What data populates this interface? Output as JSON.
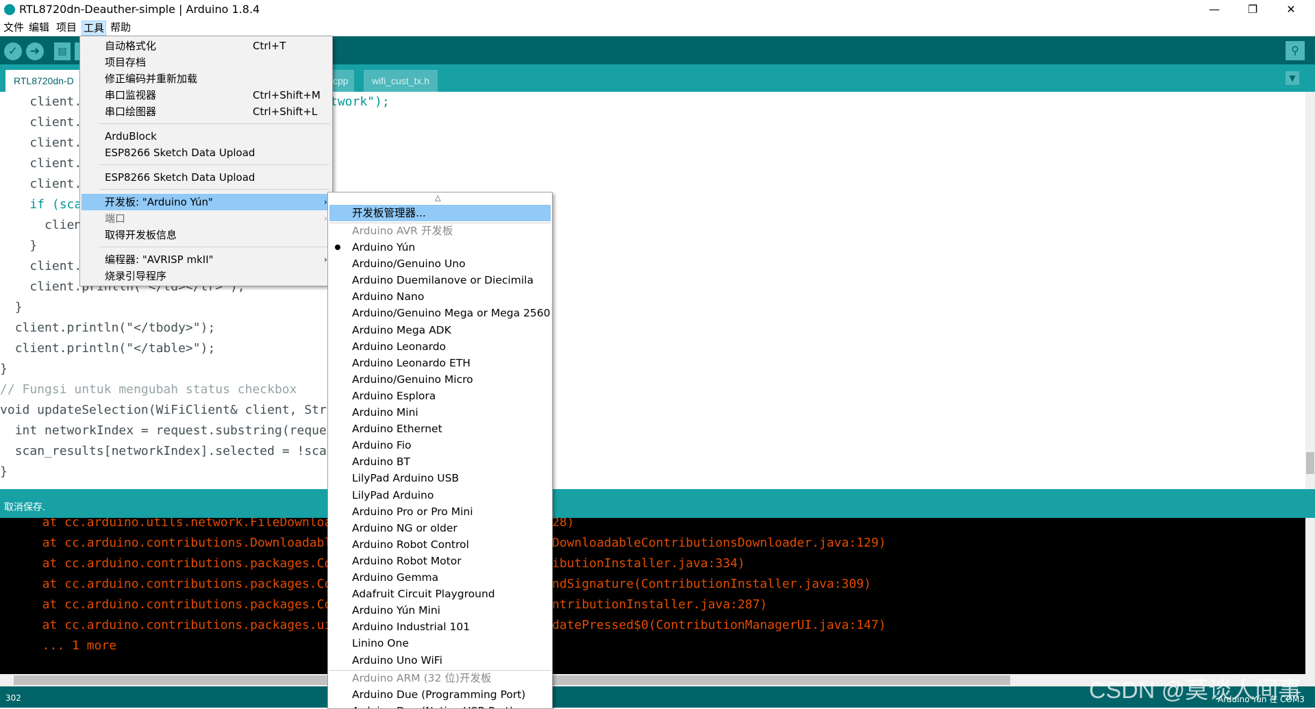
{
  "window": {
    "title": "RTL8720dn-Deauther-simple | Arduino 1.8.4",
    "minimize": "—",
    "restore": "❐",
    "close": "✕"
  },
  "menubar": [
    "文件",
    "编辑",
    "项目",
    "工具",
    "帮助"
  ],
  "tabs": {
    "active": "RTL8720dn-D",
    "hidden_partial": "cpp",
    "other": "wifi_cust_tx.h"
  },
  "editor_lines": [
    {
      "indent": "    ",
      "text": "client.",
      "tail": "twork\");"
    },
    {
      "indent": "    ",
      "text": "client.",
      "tail": ""
    },
    {
      "indent": "    ",
      "text": "client.",
      "tail": ""
    },
    {
      "indent": "    ",
      "text": "client.",
      "tail": ""
    },
    {
      "indent": "    ",
      "text": "client.",
      "tail": ""
    },
    {
      "indent": "    ",
      "text": "if (sca",
      "tail": ""
    },
    {
      "indent": "      ",
      "text": "clien",
      "tail": ""
    },
    {
      "indent": "    ",
      "text": "}",
      "tail": ""
    },
    {
      "indent": "    ",
      "text": "client.",
      "tail": ""
    },
    {
      "indent": "    ",
      "text": "client.println(\"</td></tr>\");",
      "tail": ""
    },
    {
      "indent": "  ",
      "text": "}",
      "tail": ""
    },
    {
      "indent": "  ",
      "text": "client.println(\"</tbody>\");",
      "tail": ""
    },
    {
      "indent": "  ",
      "text": "client.println(\"</table>\");",
      "tail": ""
    },
    {
      "indent": "",
      "text": "}",
      "tail": ""
    },
    {
      "indent": "",
      "text": "// Fungsi untuk mengubah status checkbox",
      "tail": ""
    },
    {
      "indent": "",
      "text": "void updateSelection(WiFiClient& client, String",
      "tail": ""
    },
    {
      "indent": "  ",
      "text": "int networkIndex = request.substring(request.",
      "tail": ""
    },
    {
      "indent": "  ",
      "text": "scan_results[networkIndex].selected = !scan_r",
      "tail": ""
    },
    {
      "indent": "",
      "text": "}",
      "tail": ""
    }
  ],
  "status": "取消保存.",
  "console_lines": [
    {
      "left": "  at cc.arduino.utils.network.FileDownload",
      "right": "28)"
    },
    {
      "left": "  at cc.arduino.contributions.Downloadable",
      "right": "DownloadableContributionsDownloader.java:129)"
    },
    {
      "left": "  at cc.arduino.contributions.packages.Con",
      "right": "ibutionInstaller.java:334)"
    },
    {
      "left": "  at cc.arduino.contributions.packages.Con",
      "right": "ndSignature(ContributionInstaller.java:309)"
    },
    {
      "left": "  at cc.arduino.contributions.packages.Con",
      "right": "ntributionInstaller.java:287)"
    },
    {
      "left": "  at cc.arduino.contributions.packages.ui.",
      "right": "datePressed$0(ContributionManagerUI.java:147)"
    },
    {
      "left": "  ... 1 more",
      "right": ""
    }
  ],
  "bottom": {
    "line_number": "302",
    "board_port": "Arduino Yún 在 COM3",
    "watermark": "CSDN @莫谈人间事"
  },
  "tools_menu": {
    "items": [
      {
        "label": "自动格式化",
        "shortcut": "Ctrl+T"
      },
      {
        "label": "项目存档",
        "shortcut": ""
      },
      {
        "label": "修正编码并重新加载",
        "shortcut": ""
      },
      {
        "label": "串口监视器",
        "shortcut": "Ctrl+Shift+M"
      },
      {
        "label": "串口绘图器",
        "shortcut": "Ctrl+Shift+L"
      },
      {
        "label": "ArduBlock",
        "shortcut": ""
      },
      {
        "label": "ESP8266 Sketch Data Upload",
        "shortcut": ""
      },
      {
        "label": "ESP8266 Sketch Data Upload",
        "shortcut": ""
      },
      {
        "label": "开发板: \"Arduino Yún\"",
        "shortcut": ""
      },
      {
        "label": "端口",
        "shortcut": ""
      },
      {
        "label": "取得开发板信息",
        "shortcut": ""
      },
      {
        "label": "编程器: \"AVRISP mkII\"",
        "shortcut": ""
      },
      {
        "label": "烧录引导程序",
        "shortcut": ""
      }
    ]
  },
  "board_menu": {
    "manager": "开发板管理器...",
    "avr_header": "Arduino AVR 开发板",
    "selected": "Arduino Yún",
    "avr_boards": [
      "Arduino Yún",
      "Arduino/Genuino Uno",
      "Arduino Duemilanove or Diecimila",
      "Arduino Nano",
      "Arduino/Genuino Mega or Mega 2560",
      "Arduino Mega ADK",
      "Arduino Leonardo",
      "Arduino Leonardo ETH",
      "Arduino/Genuino Micro",
      "Arduino Esplora",
      "Arduino Mini",
      "Arduino Ethernet",
      "Arduino Fio",
      "Arduino BT",
      "LilyPad Arduino USB",
      "LilyPad Arduino",
      "Arduino Pro or Pro Mini",
      "Arduino NG or older",
      "Arduino Robot Control",
      "Arduino Robot Motor",
      "Arduino Gemma",
      "Adafruit Circuit Playground",
      "Arduino Yún Mini",
      "Arduino Industrial 101",
      "Linino One",
      "Arduino Uno WiFi"
    ],
    "arm_header": "Arduino ARM (32 位)开发板",
    "arm_boards": [
      "Arduino Due (Programming Port)",
      "Arduino Due (Native USB Port)"
    ]
  }
}
